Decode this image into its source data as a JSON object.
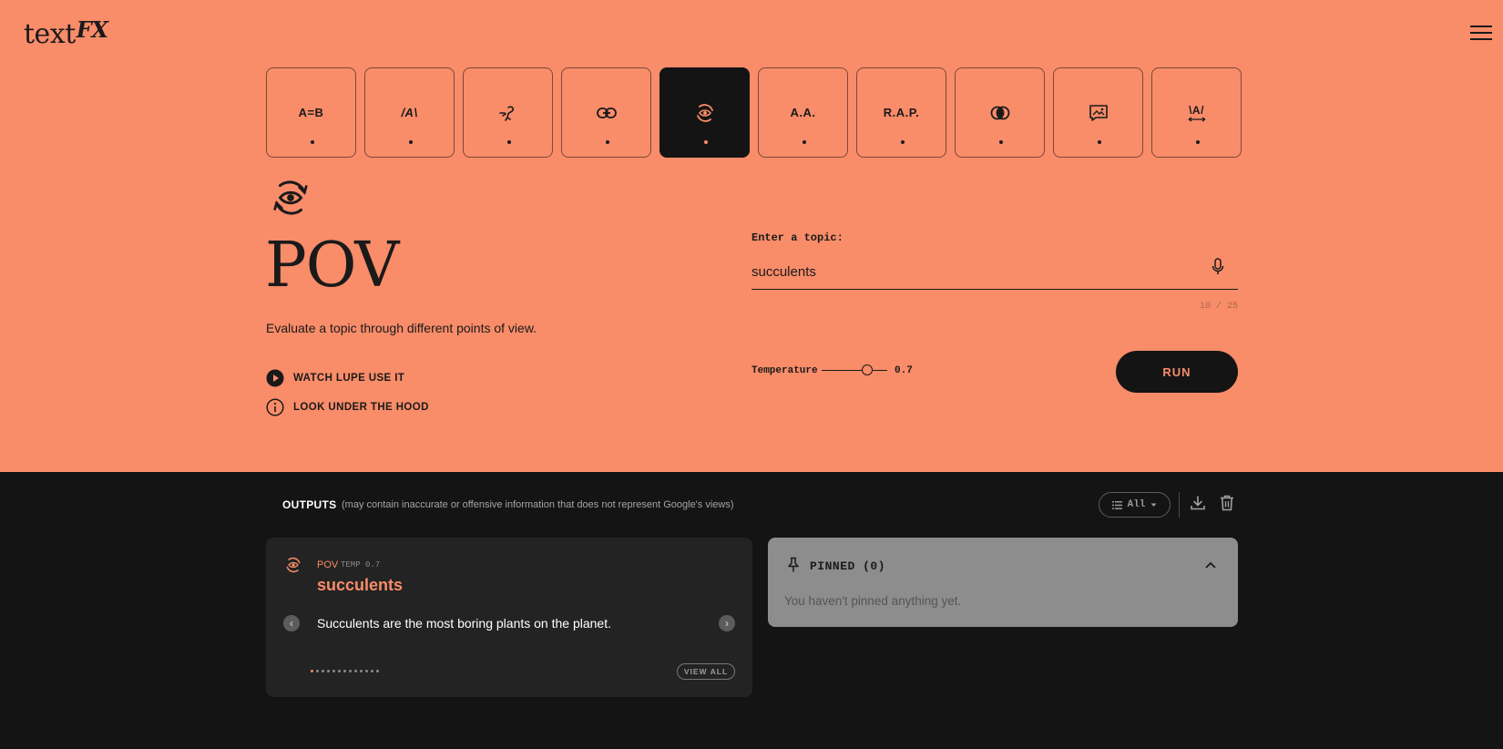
{
  "header": {
    "logo_text": "text",
    "logo_fx": "FX"
  },
  "tools": [
    {
      "id": "simile",
      "glyph": "A=B",
      "active": false
    },
    {
      "id": "explode",
      "glyph": "/A\\",
      "active": false
    },
    {
      "id": "unexpect",
      "glyph": "unexpect-icon",
      "active": false
    },
    {
      "id": "chain",
      "glyph": "link-icon",
      "active": false
    },
    {
      "id": "pov",
      "glyph": "pov-icon",
      "active": true
    },
    {
      "id": "alliteration",
      "glyph": "A.A.",
      "active": false
    },
    {
      "id": "acronym",
      "glyph": "R.A.P.",
      "active": false
    },
    {
      "id": "fuse",
      "glyph": "fuse-icon",
      "active": false
    },
    {
      "id": "scene",
      "glyph": "image-icon",
      "active": false
    },
    {
      "id": "unfold",
      "glyph": "\\A/",
      "active": false
    }
  ],
  "tool_panel": {
    "title": "POV",
    "description": "Evaluate a topic through different points of view.",
    "watch_link": "WATCH LUPE USE IT",
    "hood_link": "LOOK UNDER THE HOOD"
  },
  "form": {
    "topic_label": "Enter a topic:",
    "topic_value": "succulents",
    "counter": "10 / 25",
    "temperature_label": "Temperature",
    "temperature_value": "0.7",
    "temperature_fraction": 0.7,
    "run_label": "RUN"
  },
  "outputs": {
    "title": "OUTPUTS",
    "note": "(may contain inaccurate or offensive information that does not represent Google's views)",
    "filter_label": "All"
  },
  "output_card": {
    "tool": "POV",
    "temp": "TEMP 0.7",
    "topic": "succulents",
    "text": "Succulents are the most boring plants on the planet.",
    "page_count": 13,
    "current_page": 1,
    "view_all": "VIEW ALL"
  },
  "pinned": {
    "title": "PINNED (0)",
    "empty_text": "You haven't pinned anything yet."
  },
  "colors": {
    "accent": "#f98c69",
    "dark": "#141414",
    "card": "#232323",
    "pinned_bg": "#8d8d8d"
  }
}
